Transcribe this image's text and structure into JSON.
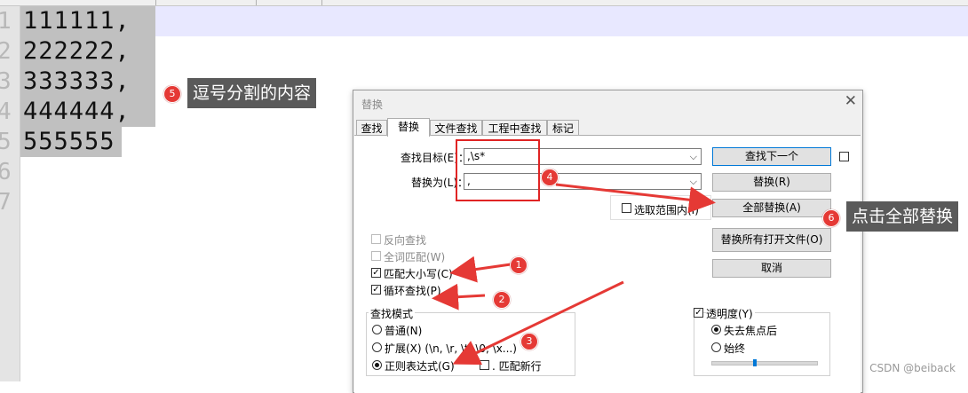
{
  "editor": {
    "lines": [
      "111111,",
      "222222,",
      "333333,",
      "444444,",
      "555555"
    ],
    "gutter_glyphs": [
      "1",
      "2",
      "3",
      "4",
      "5",
      "6",
      "7"
    ]
  },
  "dialog": {
    "title": "替换",
    "close_glyph": "✕",
    "tabs": [
      "查找",
      "替换",
      "文件查找",
      "工程中查找",
      "标记"
    ],
    "active_tab": "替换",
    "find_label": "查找目标(E)：",
    "find_value": ",\\s*",
    "replace_label": "替换为(L)：",
    "replace_value": ",",
    "buttons": {
      "find_next": "查找下一个",
      "replace": "替换(R)",
      "replace_all": "全部替换(A)",
      "replace_all_open": "替换所有打开文件(O)",
      "cancel": "取消"
    },
    "in_selection": {
      "label": "选取范围内(I)",
      "checked": false
    },
    "options": {
      "backward": {
        "label": "反向查找",
        "checked": false,
        "enabled": false
      },
      "whole_word": {
        "label": "全词匹配(W)",
        "checked": false,
        "enabled": false
      },
      "match_case": {
        "label": "匹配大小写(C)",
        "checked": true,
        "enabled": true
      },
      "wrap": {
        "label": "循环查找(P)",
        "checked": true,
        "enabled": true
      }
    },
    "search_mode": {
      "title": "查找模式",
      "normal": "普通(N)",
      "extended": "扩展(X) (\\n, \\r, \\t, \\0, \\x...)",
      "regex": "正则表达式(G)",
      "dot_newline": ". 匹配新行",
      "selected": "regex"
    },
    "transparency": {
      "label": "透明度(Y)",
      "checked": true,
      "on_lose_focus": "失去焦点后",
      "always": "始终",
      "selected": "on_lose_focus",
      "level": 0.4
    }
  },
  "annotations": [
    {
      "num": "1"
    },
    {
      "num": "2"
    },
    {
      "num": "3"
    },
    {
      "num": "4"
    },
    {
      "num": "5",
      "text": "逗号分割的内容"
    },
    {
      "num": "6",
      "text": "点击全部替换"
    }
  ],
  "watermark": "CSDN @beiback",
  "colors": {
    "annotation_red": "#e53935",
    "callout_bg": "#5a5a5a",
    "selection": "#c0c0c0",
    "current_line": "#e8e8ff"
  }
}
